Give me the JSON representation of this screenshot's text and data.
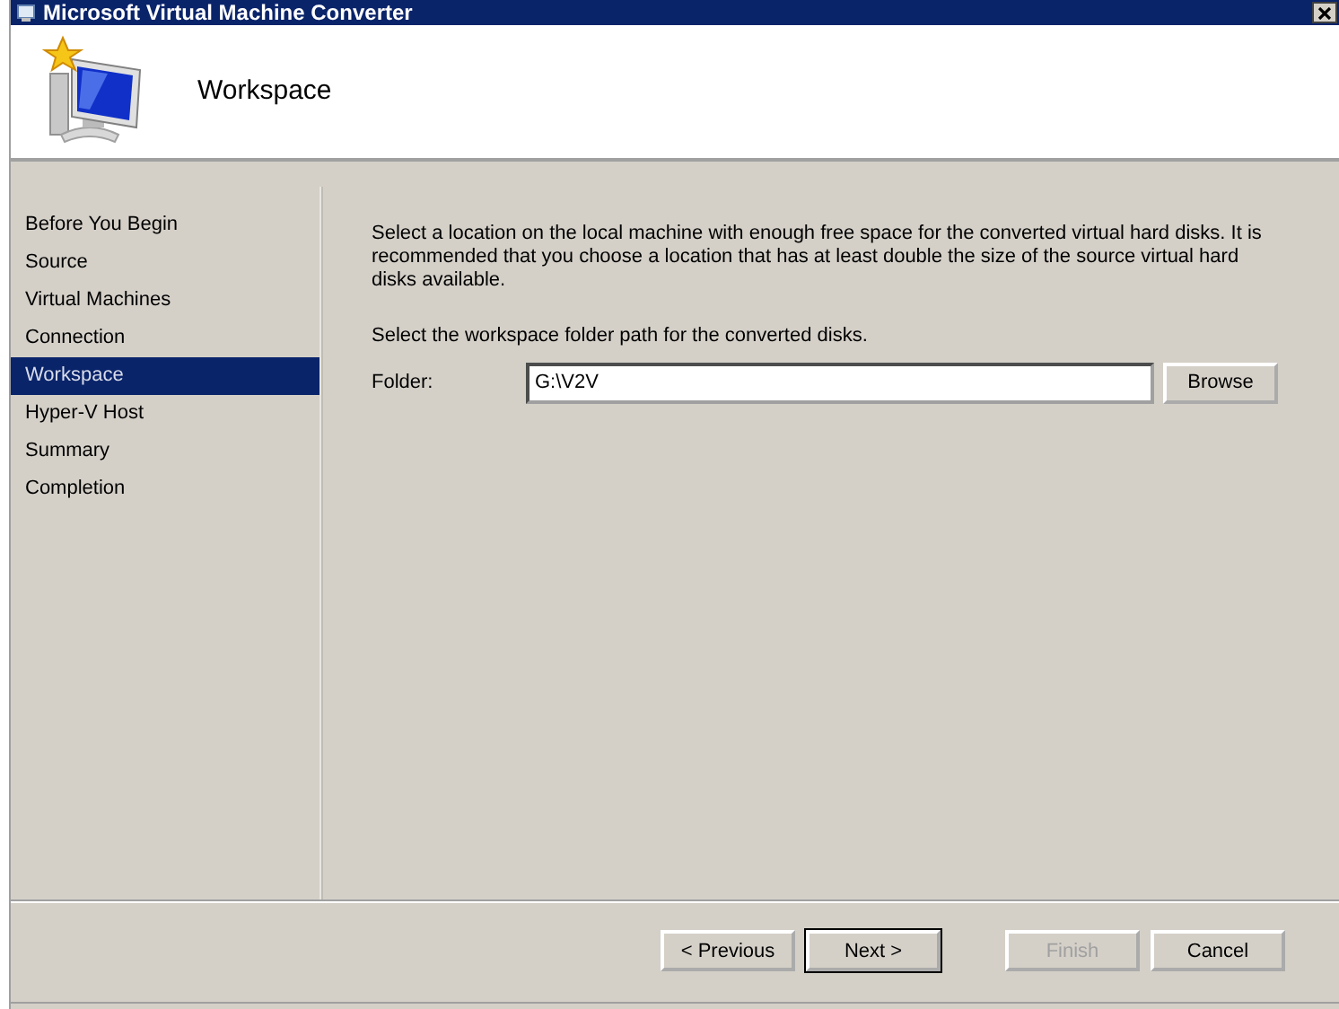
{
  "window": {
    "title": "Microsoft Virtual Machine Converter"
  },
  "header": {
    "title": "Workspace"
  },
  "steps": [
    {
      "label": "Before You Begin",
      "selected": false
    },
    {
      "label": "Source",
      "selected": false
    },
    {
      "label": "Virtual Machines",
      "selected": false
    },
    {
      "label": "Connection",
      "selected": false
    },
    {
      "label": "Workspace",
      "selected": true
    },
    {
      "label": "Hyper-V Host",
      "selected": false
    },
    {
      "label": "Summary",
      "selected": false
    },
    {
      "label": "Completion",
      "selected": false
    }
  ],
  "content": {
    "description": "Select a location on the local machine with enough free space for the converted virtual hard disks. It is recommended that you choose a location that has at least double the size of the source virtual hard disks available.",
    "instruction": "Select the workspace folder path for the converted disks.",
    "folder": {
      "label": "Folder:",
      "value": "G:\\V2V",
      "button": "Browse"
    }
  },
  "buttons": [
    {
      "label": "< Previous",
      "disabled": false,
      "default": false
    },
    {
      "label": "Next >",
      "disabled": false,
      "default": true
    },
    {
      "label": "Finish",
      "disabled": true,
      "default": false
    },
    {
      "label": "Cancel",
      "disabled": false,
      "default": false
    }
  ]
}
